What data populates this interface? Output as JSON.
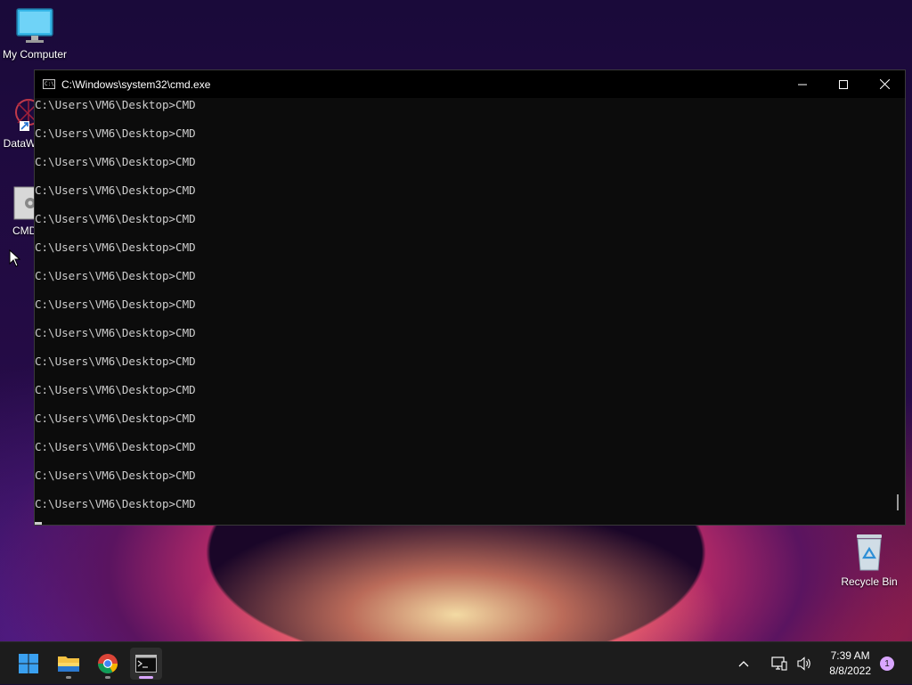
{
  "desktop": {
    "icons": [
      {
        "label": "My Computer",
        "icon": "monitor-icon"
      },
      {
        "label": "DataW",
        "icon": "datawrapper-icon"
      },
      {
        "label": "CMD",
        "icon": "cmd-shortcut-icon"
      },
      {
        "label": "Recycle Bin",
        "icon": "recycle-bin-icon"
      }
    ]
  },
  "cmd_window": {
    "title": "C:\\Windows\\system32\\cmd.exe",
    "title_icon_text": "C:\\",
    "lines": [
      "C:\\Users\\VM6\\Desktop>CMD",
      "C:\\Users\\VM6\\Desktop>CMD",
      "C:\\Users\\VM6\\Desktop>CMD",
      "C:\\Users\\VM6\\Desktop>CMD",
      "C:\\Users\\VM6\\Desktop>CMD",
      "C:\\Users\\VM6\\Desktop>CMD",
      "C:\\Users\\VM6\\Desktop>CMD",
      "C:\\Users\\VM6\\Desktop>CMD",
      "C:\\Users\\VM6\\Desktop>CMD",
      "C:\\Users\\VM6\\Desktop>CMD",
      "C:\\Users\\VM6\\Desktop>CMD",
      "C:\\Users\\VM6\\Desktop>CMD",
      "C:\\Users\\VM6\\Desktop>CMD",
      "C:\\Users\\VM6\\Desktop>CMD",
      "C:\\Users\\VM6\\Desktop>CMD"
    ],
    "buttons": {
      "minimize": "minimize-icon",
      "maximize": "maximize-icon",
      "close": "close-icon"
    }
  },
  "taskbar": {
    "apps": [
      {
        "name": "start",
        "icon": "windows-logo-icon"
      },
      {
        "name": "file-explorer",
        "icon": "folder-icon"
      },
      {
        "name": "chrome",
        "icon": "chrome-icon"
      },
      {
        "name": "command-prompt",
        "icon": "terminal-icon",
        "active": true
      }
    ],
    "tray": {
      "time": "7:39 AM",
      "date": "8/8/2022",
      "notification_count": "1"
    }
  },
  "colors": {
    "taskbar_bg": "#1c1c1c",
    "console_bg": "#0c0c0c",
    "console_text": "#cccccc",
    "accent": "#d9a6ff"
  }
}
